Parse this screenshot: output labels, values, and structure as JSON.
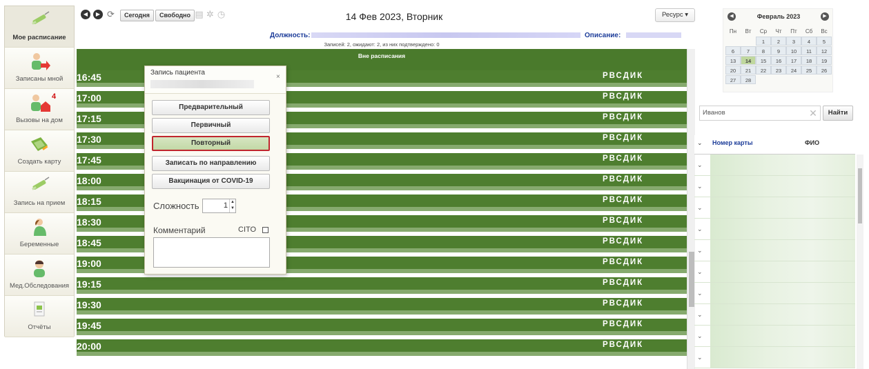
{
  "sidebar": {
    "items": [
      {
        "label": "Мое расписание",
        "icon": "syringe-icon",
        "active": true
      },
      {
        "label": "Записаны мной",
        "icon": "patient-arrow-icon"
      },
      {
        "label": "Вызовы на дом",
        "icon": "home-visit-icon",
        "badge": "4"
      },
      {
        "label": "Создать карту",
        "icon": "create-card-icon"
      },
      {
        "label": "Запись на прием",
        "icon": "appointment-icon"
      },
      {
        "label": "Беременные",
        "icon": "pregnant-icon"
      },
      {
        "label": "Мед.Обследования",
        "icon": "med-exam-icon"
      },
      {
        "label": "Отчёты",
        "icon": "reports-icon"
      }
    ]
  },
  "toolbar": {
    "today_label": "Сегодня",
    "free_label": "Свободно",
    "date_title": "14 Фев 2023, Вторник",
    "resource_label": "Ресурс ▾"
  },
  "info": {
    "position_label": "Должность:",
    "description_label": "Описание:",
    "records_info": "Записей: 2, ожидают: 2, из них подтверждено: 0"
  },
  "schedule": {
    "outside_label": "Вне расписания",
    "codes": "РВСДИК",
    "slots": [
      "16:45",
      "17:00",
      "17:15",
      "17:30",
      "17:45",
      "18:00",
      "18:15",
      "18:30",
      "18:45",
      "19:00",
      "19:15",
      "19:30",
      "19:45",
      "20:00"
    ]
  },
  "dialog": {
    "title": "Запись пациента",
    "close": "×",
    "buttons": [
      "Предварительный",
      "Первичный",
      "Повторный",
      "Записать по направлению",
      "Вакцинация от COVID-19"
    ],
    "selected_button": "Повторный",
    "complexity_label": "Сложность",
    "complexity_value": "1",
    "comment_label": "Комментарий",
    "cito_label": "CITO"
  },
  "calendar": {
    "month": "Февраль 2023",
    "weekdays": [
      "Пн",
      "Вт",
      "Ср",
      "Чт",
      "Пт",
      "Сб",
      "Вс"
    ],
    "weeks": [
      [
        "",
        "",
        "1",
        "2",
        "3",
        "4",
        "5"
      ],
      [
        "6",
        "7",
        "8",
        "9",
        "10",
        "11",
        "12"
      ],
      [
        "13",
        "14",
        "15",
        "16",
        "17",
        "18",
        "19"
      ],
      [
        "20",
        "21",
        "22",
        "23",
        "24",
        "25",
        "26"
      ],
      [
        "27",
        "28",
        "",
        "",
        "",
        "",
        ""
      ]
    ],
    "today": "14"
  },
  "search": {
    "value": "Иванов",
    "button_label": "Найти",
    "clear": "✕"
  },
  "patients_grid": {
    "col_card": "Номер карты",
    "col_fio": "ФИО"
  },
  "colors": {
    "slot_green": "#4e7e2f",
    "slot_separator": "#86aa6e",
    "link_blue": "#1c3c99",
    "selected_outline": "#c0252d"
  }
}
